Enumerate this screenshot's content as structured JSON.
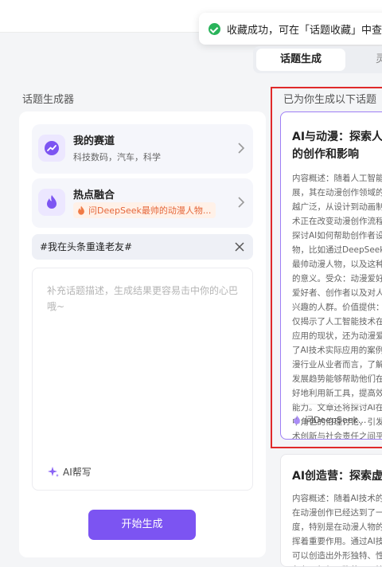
{
  "toast": {
    "message": "收藏成功，可在「话题收藏」中查"
  },
  "tabs": {
    "active": "话题生成",
    "other": "灵"
  },
  "left": {
    "section_title": "话题生成器",
    "track": {
      "title": "我的赛道",
      "subtitle": "科技数码，汽车，科学"
    },
    "hot": {
      "title": "热点融合",
      "tag": "问DeepSeek最帅的动漫人物..."
    },
    "topic_value": "#我在头条重逢老友#",
    "textarea_placeholder": "补充话题描述，生成结果更容易击中你的心巴哦~",
    "ai_help": "AI帮写",
    "start_button": "开始生成"
  },
  "right": {
    "title": "已为你生成以下话题",
    "card1": {
      "title": "AI与动漫：探索人工智能的创作和影响",
      "body": "内容概述：随着人工智能技术的发展，其在动漫创作领域的应用越来越广泛，从设计到动画制作，AI技术正在改变动漫创作流程。本文将探讨AI如何帮助创作者设计动漫人物，比如通过DeepSeek评选出的最帅动漫人物，以及这种技术背后的意义。受众：动漫爱好者、科技爱好者、创作者以及对人工智能感兴趣的人群。价值提供：此选题不仅揭示了人工智能技术在动漫领域应用的现状，还为动漫爱好者提供了AI技术实际应用的案例，对于动漫行业从业者而言，了解AI技术的发展趋势能够帮助他们在工作中更好地利用新工具，提高效率和创新能力。文章还将探讨AI在动漫作品中角色的伦理讨论，引发读者对技术创新与社会责任之间平衡的思考。",
      "source": "问DeepSeek..."
    },
    "card2": {
      "title": "AI创造营：探索虚拟偶像",
      "body": "内容概述：随着AI技术的进步，AI在动漫创作已经达到了一个新的高度，特别是在动漫人物的创作中发挥着重要作用。通过AI技术，我们可以创造出外形独特、性格鲜明的角色，如何正确使用AI技术"
    }
  },
  "colors": {
    "accent": "#7c54f2",
    "success": "#29b35a",
    "highlight_border": "#e02a2a",
    "hot_tag_text": "#e5673a"
  }
}
